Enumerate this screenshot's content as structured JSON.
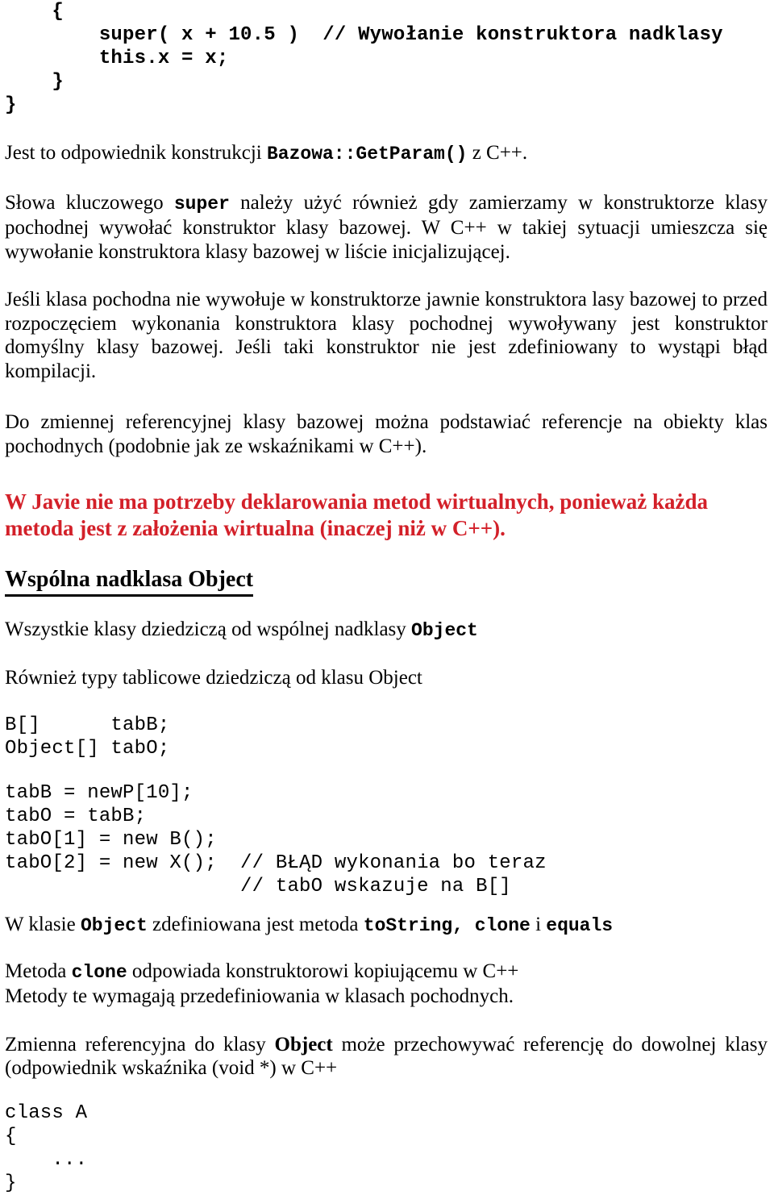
{
  "document": {
    "language": "pl",
    "topic": "Java: super, dziedziczenie i klasa Object",
    "colors": {
      "text": "#000000",
      "emphasis_red": "#D32029",
      "background": "#FFFFFF"
    }
  },
  "code_block_1": {
    "lines": "    {\n        super( x + 10.5 )  // Wywołanie konstruktora nadklasy\n        this.x = x;\n    }\n}"
  },
  "paragraph_1": {
    "before": "Jest to odpowiednik konstrukcji ",
    "mono": "Bazowa::GetParam()",
    "after": " z C++."
  },
  "paragraph_2": {
    "before": "Słowa kluczowego ",
    "mono": "super",
    "after": " należy użyć również gdy zamierzamy w konstruktorze klasy pochodnej wywołać konstruktor klasy bazowej. W C++ w takiej sytuacji umieszcza się wywołanie konstruktora klasy bazowej w liście inicjalizującej."
  },
  "paragraph_3": {
    "text": "Jeśli klasa pochodna nie wywołuje w konstruktorze jawnie konstruktora lasy bazowej to przed rozpoczęciem wykonania konstruktora klasy pochodnej wywoływany jest konstruktor domyślny klasy bazowej. Jeśli taki konstruktor nie jest zdefiniowany to wystąpi błąd kompilacji."
  },
  "paragraph_4": {
    "text": "Do zmiennej referencyjnej klasy bazowej można podstawiać referencje na obiekty klas pochodnych (podobnie jak ze wskaźnikami w C++)."
  },
  "red_note": {
    "text": "W Javie nie ma potrzeby deklarowania metod wirtualnych, ponieważ każda metoda jest z założenia wirtualna (inaczej niż w C++)."
  },
  "heading_object": {
    "text": "Wspólna nadklasa Object"
  },
  "paragraph_5": {
    "before": "Wszystkie klasy dziedziczą od wspólnej nadklasy ",
    "mono": "Object",
    "after": ""
  },
  "paragraph_6": {
    "text": "Również typy tablicowe dziedziczą od klasu Object"
  },
  "code_block_2": {
    "lines": "B[]      tabB;\nObject[] tabO;"
  },
  "code_block_3": {
    "lines": "tabB = newP[10];\ntabO = tabB;\ntabO[1] = new B();\ntabO[2] = new X();  // BŁĄD wykonania bo teraz\n                    // tabO wskazuje na B[]"
  },
  "paragraph_7": {
    "p1": "W klasie ",
    "mono1": "Object",
    "p2": " zdefiniowana jest metoda ",
    "mono2": "toString,  clone",
    "p3": " i ",
    "mono3": "equals"
  },
  "paragraph_8": {
    "line1_before": "Metoda ",
    "line1_mono": "clone",
    "line1_after": " odpowiada konstruktorowi kopiującemu w C++",
    "line2": "Metody te wymagają przedefiniowania w klasach pochodnych."
  },
  "paragraph_9": {
    "before": "Zmienna referencyjna do klasy ",
    "bold": "Object",
    "after": " może przechowywać referencję do dowolnej klasy (odpowiednik wskaźnika (void *) w C++"
  },
  "code_block_4": {
    "lines": "class A\n{\n    ...\n}"
  }
}
